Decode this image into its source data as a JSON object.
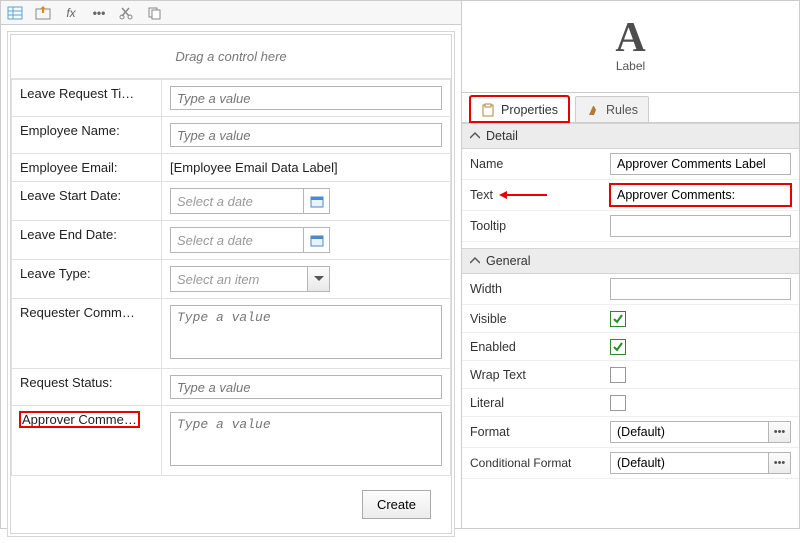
{
  "canvas": {
    "drop_hint": "Drag a control here",
    "rows": {
      "title_label": "Leave Request Ti…",
      "title_ph": "Type a value",
      "empname_label": "Employee Name:",
      "empname_ph": "Type a value",
      "empemail_label": "Employee Email:",
      "empemail_value": "[Employee Email Data Label]",
      "startdate_label": "Leave Start Date:",
      "date_ph": "Select a date",
      "enddate_label": "Leave End Date:",
      "type_label": "Leave Type:",
      "type_ph": "Select an item",
      "reqcomm_label": "Requester Comm…",
      "reqcomm_ph": "Type a value",
      "status_label": "Request Status:",
      "status_ph": "Type a value",
      "apprcomm_label": "Approver Comme…",
      "apprcomm_ph": "Type a value"
    },
    "create_btn": "Create"
  },
  "rightPanel": {
    "titleGlyph": "A",
    "titleText": "Label",
    "tabs": {
      "properties": "Properties",
      "rules": "Rules"
    },
    "sections": {
      "detail": "Detail",
      "general": "General"
    },
    "detail": {
      "name_label": "Name",
      "name_value": "Approver Comments Label",
      "text_label": "Text",
      "text_value": "Approver Comments:",
      "tooltip_label": "Tooltip",
      "tooltip_value": ""
    },
    "general": {
      "width_label": "Width",
      "width_value": "",
      "visible_label": "Visible",
      "enabled_label": "Enabled",
      "wrap_label": "Wrap Text",
      "literal_label": "Literal",
      "format_label": "Format",
      "format_value": "(Default)",
      "condformat_label": "Conditional Format",
      "condformat_value": "(Default)"
    }
  }
}
